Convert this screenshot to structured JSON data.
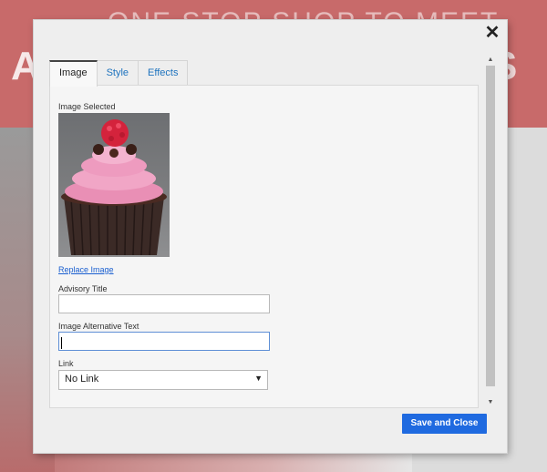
{
  "background": {
    "hero_text": "ONE STOP SHOP TO MEET",
    "hero_left_letter": "A",
    "hero_right_letter": "S"
  },
  "modal": {
    "close_icon": "close-icon",
    "tabs": [
      {
        "label": "Image",
        "active": true
      },
      {
        "label": "Style",
        "active": false
      },
      {
        "label": "Effects",
        "active": false
      }
    ],
    "image_selected_label": "Image Selected",
    "replace_image_link": "Replace Image",
    "advisory_title_label": "Advisory Title",
    "advisory_title_value": "",
    "alt_text_label": "Image Alternative Text",
    "alt_text_value": "",
    "link_label": "Link",
    "link_selected": "No Link",
    "save_button": "Save and Close"
  },
  "colors": {
    "accent": "#1f6ae0",
    "link": "#1a5fd0",
    "hero_bg": "#c86a6a",
    "modal_bg": "#eeeeee"
  }
}
